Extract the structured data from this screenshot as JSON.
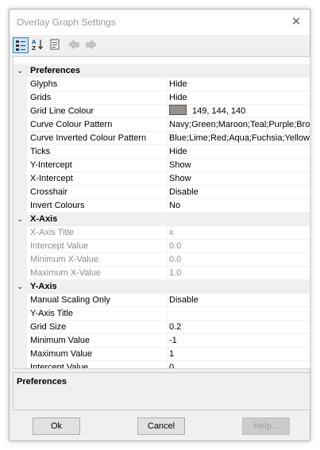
{
  "window": {
    "title": "Overlay Graph Settings",
    "close_glyph": "✕"
  },
  "toolbar": {
    "buttons": [
      {
        "name": "categorized-icon",
        "active": true
      },
      {
        "name": "alphabetical-sort-icon",
        "active": false
      },
      {
        "name": "property-pages-icon",
        "active": false
      },
      {
        "name": "back-icon",
        "active": false
      },
      {
        "name": "forward-icon",
        "active": false
      }
    ]
  },
  "categories": {
    "preferences": "Preferences",
    "xaxis": "X-Axis",
    "yaxis": "Y-Axis",
    "collapse_glyph": "⌄"
  },
  "preferences": {
    "glyphs": {
      "label": "Glyphs",
      "value": "Hide"
    },
    "grids": {
      "label": "Grids",
      "value": "Hide"
    },
    "grid_line_colour": {
      "label": "Grid Line Colour",
      "value": "149, 144, 140",
      "swatch": "#95908c"
    },
    "curve_colour_pattern": {
      "label": "Curve Colour Pattern",
      "value": "Navy;Green;Maroon;Teal;Purple;Brown"
    },
    "curve_inverted_colour_pattern": {
      "label": "Curve Inverted Colour Pattern",
      "value": "Blue;Lime;Red;Aqua;Fuchsia;Yellow"
    },
    "ticks": {
      "label": "Ticks",
      "value": "Hide"
    },
    "y_intercept": {
      "label": "Y-Intercept",
      "value": "Show"
    },
    "x_intercept": {
      "label": "X-Intercept",
      "value": "Show"
    },
    "crosshair": {
      "label": "Crosshair",
      "value": "Disable"
    },
    "invert_colours": {
      "label": "Invert Colours",
      "value": "No"
    }
  },
  "xaxis": {
    "title": {
      "label": "X-Axis Title",
      "value": "x"
    },
    "intercept": {
      "label": "Intercept Value",
      "value": "0.0"
    },
    "min": {
      "label": "Minimum X-Value",
      "value": "0.0"
    },
    "max": {
      "label": "Maximum X-Value",
      "value": "1.0"
    }
  },
  "yaxis": {
    "manual_scaling": {
      "label": "Manual Scaling Only",
      "value": "Disable"
    },
    "title": {
      "label": "Y-Axis Title",
      "value": ""
    },
    "grid_size": {
      "label": "Grid Size",
      "value": "0.2"
    },
    "min": {
      "label": "Minimum Value",
      "value": "-1"
    },
    "max": {
      "label": "Maximum Value",
      "value": "1"
    },
    "intercept": {
      "label": "Intercept Value",
      "value": "0"
    }
  },
  "description": {
    "title": "Preferences"
  },
  "buttons": {
    "ok": "Ok",
    "cancel": "Cancel",
    "help": "Help..."
  }
}
